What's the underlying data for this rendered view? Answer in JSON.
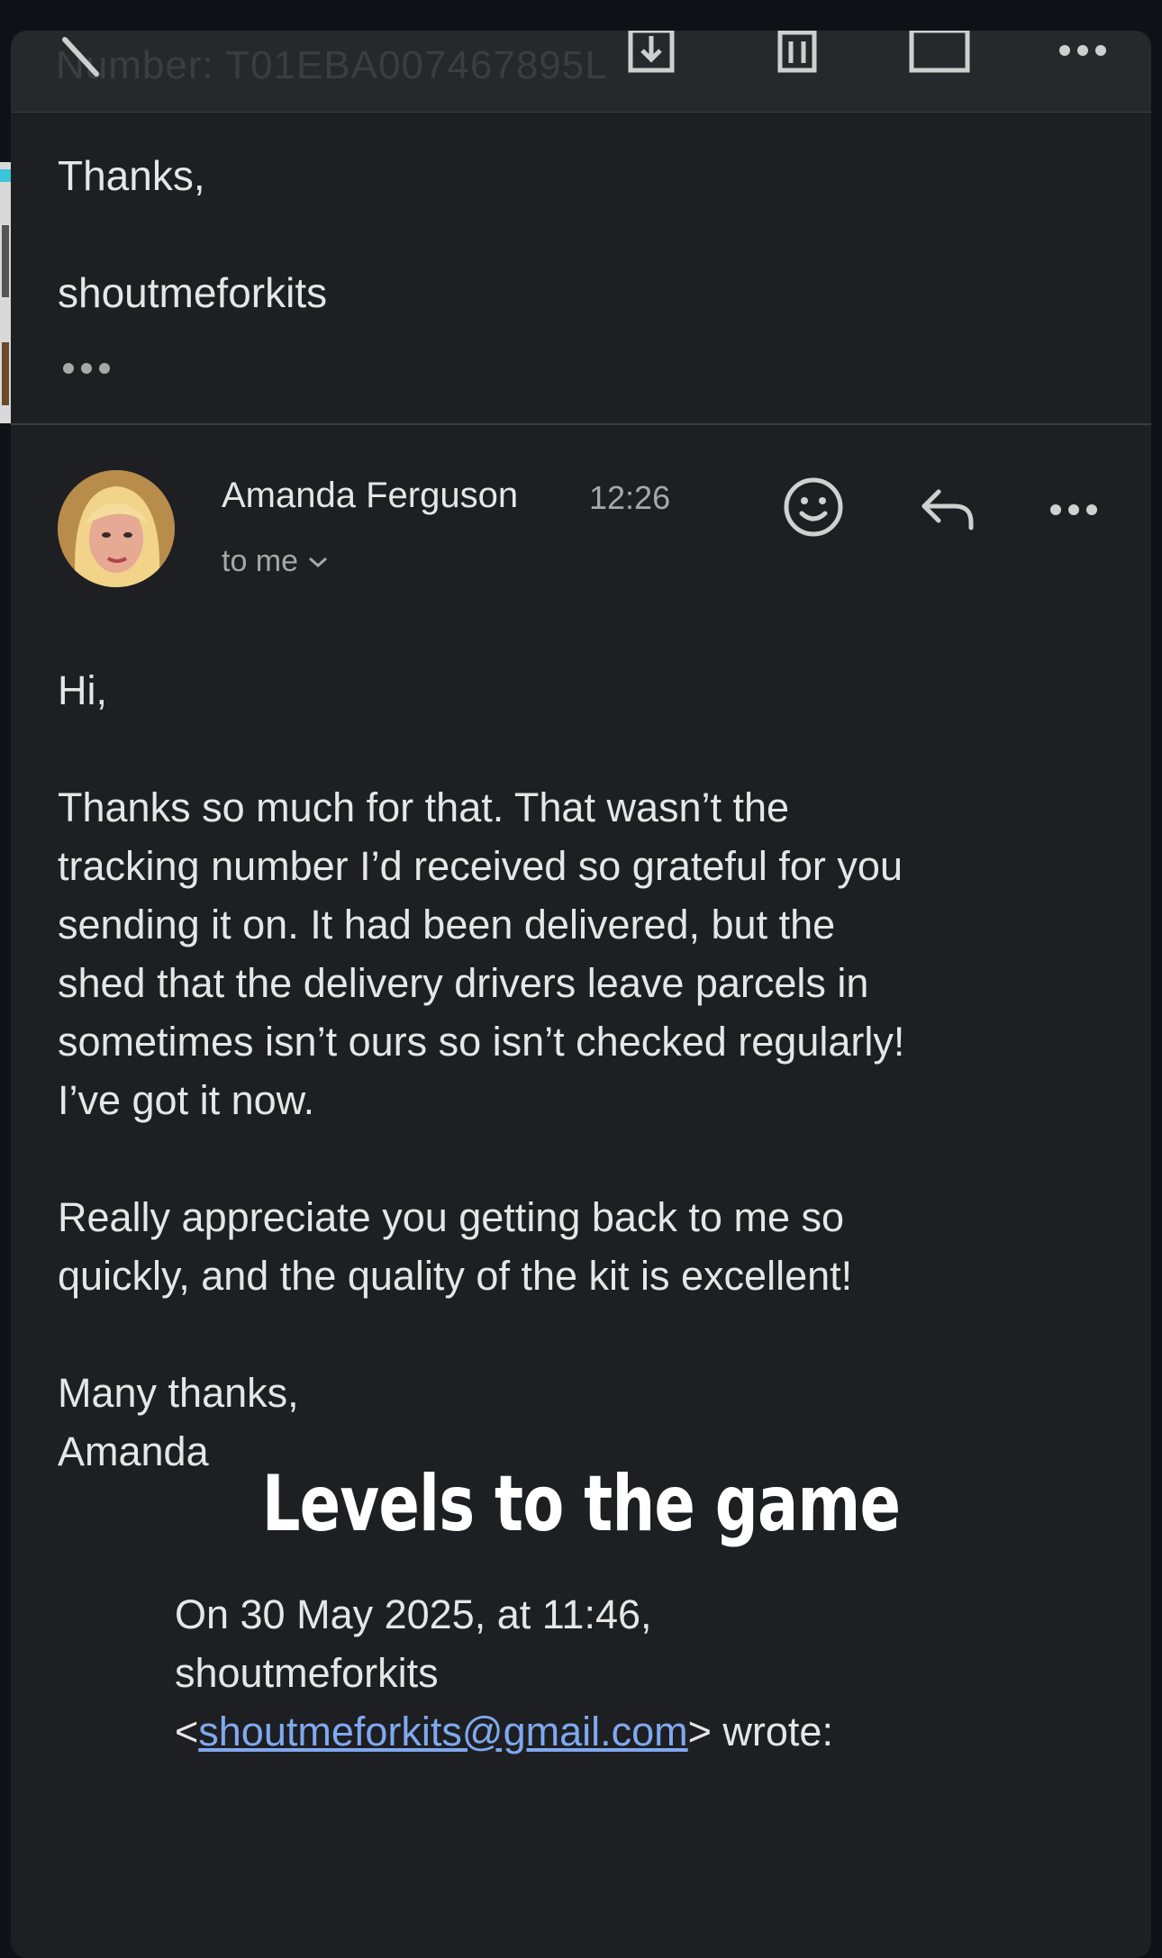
{
  "top_bar": {
    "partial_text": "Number: T01EBA007467895L"
  },
  "previous_message": {
    "closing": "Thanks,",
    "signature": "shoutmeforkits",
    "more_label": "•••"
  },
  "message": {
    "sender_name": "Amanda Ferguson",
    "time": "12:26",
    "recipient_label": "to me",
    "body": {
      "greeting": "Hi,",
      "paragraph1": "Thanks so much for that. That wasn’t the\ntracking number I’d received so grateful for you\nsending it on. It had been delivered, but the\nshed that the delivery drivers leave parcels in\nsometimes isn’t ours so isn’t checked regularly!\nI’ve got it now.",
      "paragraph2": "Really appreciate you getting back to me so\nquickly, and the quality of the kit is excellent!",
      "signoff_line1": "Many thanks,",
      "signoff_line2": "Amanda"
    },
    "quote": {
      "line1": "On 30 May 2025, at 11:46,",
      "line2": "shoutmeforkits",
      "email": "shoutmeforkits@gmail.com",
      "suffix": "> wrote:",
      "prefix": "<"
    }
  },
  "overlay": {
    "caption": "Levels to the game"
  },
  "colors": {
    "background": "#1e1f22",
    "link": "#7fa9f0",
    "text": "#e6e6e6",
    "muted": "#a8a8a8"
  }
}
